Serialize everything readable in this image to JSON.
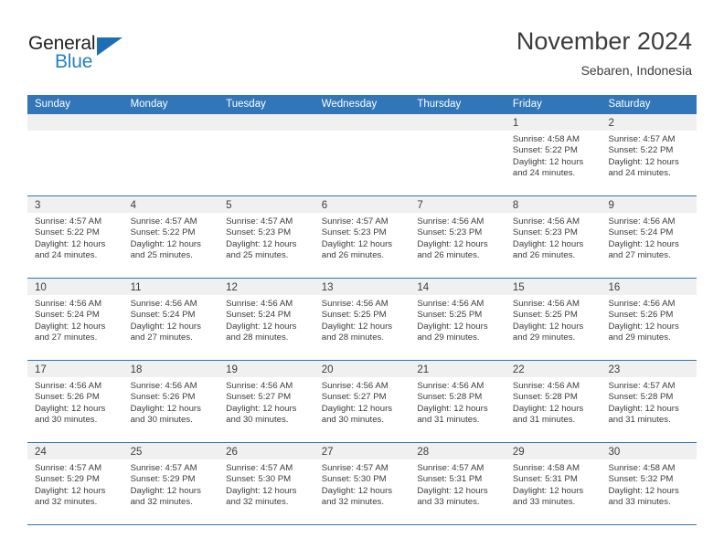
{
  "brand": {
    "name_part1": "General",
    "name_part2": "Blue"
  },
  "header": {
    "title": "November 2024",
    "subtitle": "Sebaren, Indonesia"
  },
  "colors": {
    "header_blue": "#3076b8",
    "brand_blue": "#2580c3",
    "day_strip": "#f0f0f0",
    "text": "#3c3c3c"
  },
  "weekdays": [
    "Sunday",
    "Monday",
    "Tuesday",
    "Wednesday",
    "Thursday",
    "Friday",
    "Saturday"
  ],
  "labels": {
    "sunrise": "Sunrise:",
    "sunset": "Sunset:",
    "daylight": "Daylight:"
  },
  "weeks": [
    [
      {
        "day": "",
        "sunrise": "",
        "sunset": "",
        "daylight1": "",
        "daylight2": ""
      },
      {
        "day": "",
        "sunrise": "",
        "sunset": "",
        "daylight1": "",
        "daylight2": ""
      },
      {
        "day": "",
        "sunrise": "",
        "sunset": "",
        "daylight1": "",
        "daylight2": ""
      },
      {
        "day": "",
        "sunrise": "",
        "sunset": "",
        "daylight1": "",
        "daylight2": ""
      },
      {
        "day": "",
        "sunrise": "",
        "sunset": "",
        "daylight1": "",
        "daylight2": ""
      },
      {
        "day": "1",
        "sunrise": "Sunrise: 4:58 AM",
        "sunset": "Sunset: 5:22 PM",
        "daylight1": "Daylight: 12 hours",
        "daylight2": "and 24 minutes."
      },
      {
        "day": "2",
        "sunrise": "Sunrise: 4:57 AM",
        "sunset": "Sunset: 5:22 PM",
        "daylight1": "Daylight: 12 hours",
        "daylight2": "and 24 minutes."
      }
    ],
    [
      {
        "day": "3",
        "sunrise": "Sunrise: 4:57 AM",
        "sunset": "Sunset: 5:22 PM",
        "daylight1": "Daylight: 12 hours",
        "daylight2": "and 24 minutes."
      },
      {
        "day": "4",
        "sunrise": "Sunrise: 4:57 AM",
        "sunset": "Sunset: 5:22 PM",
        "daylight1": "Daylight: 12 hours",
        "daylight2": "and 25 minutes."
      },
      {
        "day": "5",
        "sunrise": "Sunrise: 4:57 AM",
        "sunset": "Sunset: 5:23 PM",
        "daylight1": "Daylight: 12 hours",
        "daylight2": "and 25 minutes."
      },
      {
        "day": "6",
        "sunrise": "Sunrise: 4:57 AM",
        "sunset": "Sunset: 5:23 PM",
        "daylight1": "Daylight: 12 hours",
        "daylight2": "and 26 minutes."
      },
      {
        "day": "7",
        "sunrise": "Sunrise: 4:56 AM",
        "sunset": "Sunset: 5:23 PM",
        "daylight1": "Daylight: 12 hours",
        "daylight2": "and 26 minutes."
      },
      {
        "day": "8",
        "sunrise": "Sunrise: 4:56 AM",
        "sunset": "Sunset: 5:23 PM",
        "daylight1": "Daylight: 12 hours",
        "daylight2": "and 26 minutes."
      },
      {
        "day": "9",
        "sunrise": "Sunrise: 4:56 AM",
        "sunset": "Sunset: 5:24 PM",
        "daylight1": "Daylight: 12 hours",
        "daylight2": "and 27 minutes."
      }
    ],
    [
      {
        "day": "10",
        "sunrise": "Sunrise: 4:56 AM",
        "sunset": "Sunset: 5:24 PM",
        "daylight1": "Daylight: 12 hours",
        "daylight2": "and 27 minutes."
      },
      {
        "day": "11",
        "sunrise": "Sunrise: 4:56 AM",
        "sunset": "Sunset: 5:24 PM",
        "daylight1": "Daylight: 12 hours",
        "daylight2": "and 27 minutes."
      },
      {
        "day": "12",
        "sunrise": "Sunrise: 4:56 AM",
        "sunset": "Sunset: 5:24 PM",
        "daylight1": "Daylight: 12 hours",
        "daylight2": "and 28 minutes."
      },
      {
        "day": "13",
        "sunrise": "Sunrise: 4:56 AM",
        "sunset": "Sunset: 5:25 PM",
        "daylight1": "Daylight: 12 hours",
        "daylight2": "and 28 minutes."
      },
      {
        "day": "14",
        "sunrise": "Sunrise: 4:56 AM",
        "sunset": "Sunset: 5:25 PM",
        "daylight1": "Daylight: 12 hours",
        "daylight2": "and 29 minutes."
      },
      {
        "day": "15",
        "sunrise": "Sunrise: 4:56 AM",
        "sunset": "Sunset: 5:25 PM",
        "daylight1": "Daylight: 12 hours",
        "daylight2": "and 29 minutes."
      },
      {
        "day": "16",
        "sunrise": "Sunrise: 4:56 AM",
        "sunset": "Sunset: 5:26 PM",
        "daylight1": "Daylight: 12 hours",
        "daylight2": "and 29 minutes."
      }
    ],
    [
      {
        "day": "17",
        "sunrise": "Sunrise: 4:56 AM",
        "sunset": "Sunset: 5:26 PM",
        "daylight1": "Daylight: 12 hours",
        "daylight2": "and 30 minutes."
      },
      {
        "day": "18",
        "sunrise": "Sunrise: 4:56 AM",
        "sunset": "Sunset: 5:26 PM",
        "daylight1": "Daylight: 12 hours",
        "daylight2": "and 30 minutes."
      },
      {
        "day": "19",
        "sunrise": "Sunrise: 4:56 AM",
        "sunset": "Sunset: 5:27 PM",
        "daylight1": "Daylight: 12 hours",
        "daylight2": "and 30 minutes."
      },
      {
        "day": "20",
        "sunrise": "Sunrise: 4:56 AM",
        "sunset": "Sunset: 5:27 PM",
        "daylight1": "Daylight: 12 hours",
        "daylight2": "and 30 minutes."
      },
      {
        "day": "21",
        "sunrise": "Sunrise: 4:56 AM",
        "sunset": "Sunset: 5:28 PM",
        "daylight1": "Daylight: 12 hours",
        "daylight2": "and 31 minutes."
      },
      {
        "day": "22",
        "sunrise": "Sunrise: 4:56 AM",
        "sunset": "Sunset: 5:28 PM",
        "daylight1": "Daylight: 12 hours",
        "daylight2": "and 31 minutes."
      },
      {
        "day": "23",
        "sunrise": "Sunrise: 4:57 AM",
        "sunset": "Sunset: 5:28 PM",
        "daylight1": "Daylight: 12 hours",
        "daylight2": "and 31 minutes."
      }
    ],
    [
      {
        "day": "24",
        "sunrise": "Sunrise: 4:57 AM",
        "sunset": "Sunset: 5:29 PM",
        "daylight1": "Daylight: 12 hours",
        "daylight2": "and 32 minutes."
      },
      {
        "day": "25",
        "sunrise": "Sunrise: 4:57 AM",
        "sunset": "Sunset: 5:29 PM",
        "daylight1": "Daylight: 12 hours",
        "daylight2": "and 32 minutes."
      },
      {
        "day": "26",
        "sunrise": "Sunrise: 4:57 AM",
        "sunset": "Sunset: 5:30 PM",
        "daylight1": "Daylight: 12 hours",
        "daylight2": "and 32 minutes."
      },
      {
        "day": "27",
        "sunrise": "Sunrise: 4:57 AM",
        "sunset": "Sunset: 5:30 PM",
        "daylight1": "Daylight: 12 hours",
        "daylight2": "and 32 minutes."
      },
      {
        "day": "28",
        "sunrise": "Sunrise: 4:57 AM",
        "sunset": "Sunset: 5:31 PM",
        "daylight1": "Daylight: 12 hours",
        "daylight2": "and 33 minutes."
      },
      {
        "day": "29",
        "sunrise": "Sunrise: 4:58 AM",
        "sunset": "Sunset: 5:31 PM",
        "daylight1": "Daylight: 12 hours",
        "daylight2": "and 33 minutes."
      },
      {
        "day": "30",
        "sunrise": "Sunrise: 4:58 AM",
        "sunset": "Sunset: 5:32 PM",
        "daylight1": "Daylight: 12 hours",
        "daylight2": "and 33 minutes."
      }
    ]
  ]
}
